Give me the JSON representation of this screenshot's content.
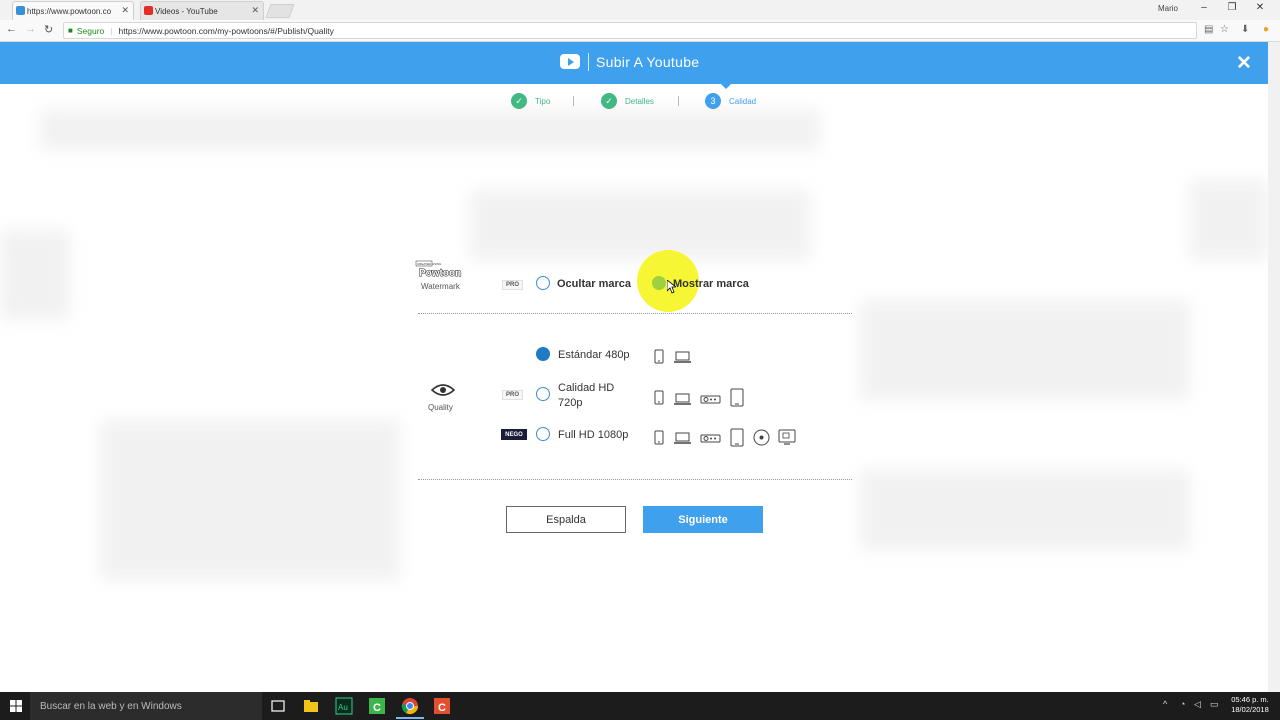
{
  "browser": {
    "tabs": [
      {
        "title": "https://www.powtoon.co",
        "active": true,
        "favicon_color": "#3a8fd6"
      },
      {
        "title": "Videos - YouTube",
        "active": false,
        "favicon_color": "#e52d27"
      }
    ],
    "user": "Mario",
    "secure_label": "Seguro",
    "url": "https://www.powtoon.com/my-powtoons/#/Publish/Quality"
  },
  "modal": {
    "title": "Subir A Youtube",
    "steps": [
      {
        "label": "Tipo",
        "state": "done",
        "marker": "✓"
      },
      {
        "label": "Detalles",
        "state": "done",
        "marker": "✓"
      },
      {
        "label": "Calidad",
        "state": "current",
        "marker": "3"
      }
    ],
    "watermark": {
      "label": "Watermark",
      "logo_text": "Powtoon",
      "logo_small": "CREATED USING",
      "pro_badge": "PRO",
      "options": [
        {
          "label": "Ocultar marca",
          "checked": false
        },
        {
          "label": "Mostrar marca",
          "checked": true
        }
      ]
    },
    "quality": {
      "label": "Quality",
      "options": [
        {
          "label": "Estándar 480p",
          "checked": true,
          "badge": "",
          "devices": [
            "phone-icon",
            "laptop-icon"
          ]
        },
        {
          "label_line1": "Calidad HD",
          "label_line2": "720p",
          "checked": false,
          "badge": "PRO",
          "devices": [
            "phone-icon",
            "laptop-icon",
            "projector-icon",
            "tablet-icon"
          ]
        },
        {
          "label": "Full HD 1080p",
          "checked": false,
          "badge": "NEGO",
          "devices": [
            "phone-icon",
            "laptop-icon",
            "projector-icon",
            "tablet-icon",
            "disc-icon",
            "tv-icon"
          ]
        }
      ]
    },
    "buttons": {
      "back": "Espalda",
      "next": "Siguiente"
    }
  },
  "taskbar": {
    "search_placeholder": "Buscar en la web y en Windows",
    "time": "05:46 p. m.",
    "date": "18/02/2018"
  },
  "colors": {
    "accent": "#3fa0ee",
    "done": "#42b883",
    "radio_checked": "#1f7bc2"
  }
}
